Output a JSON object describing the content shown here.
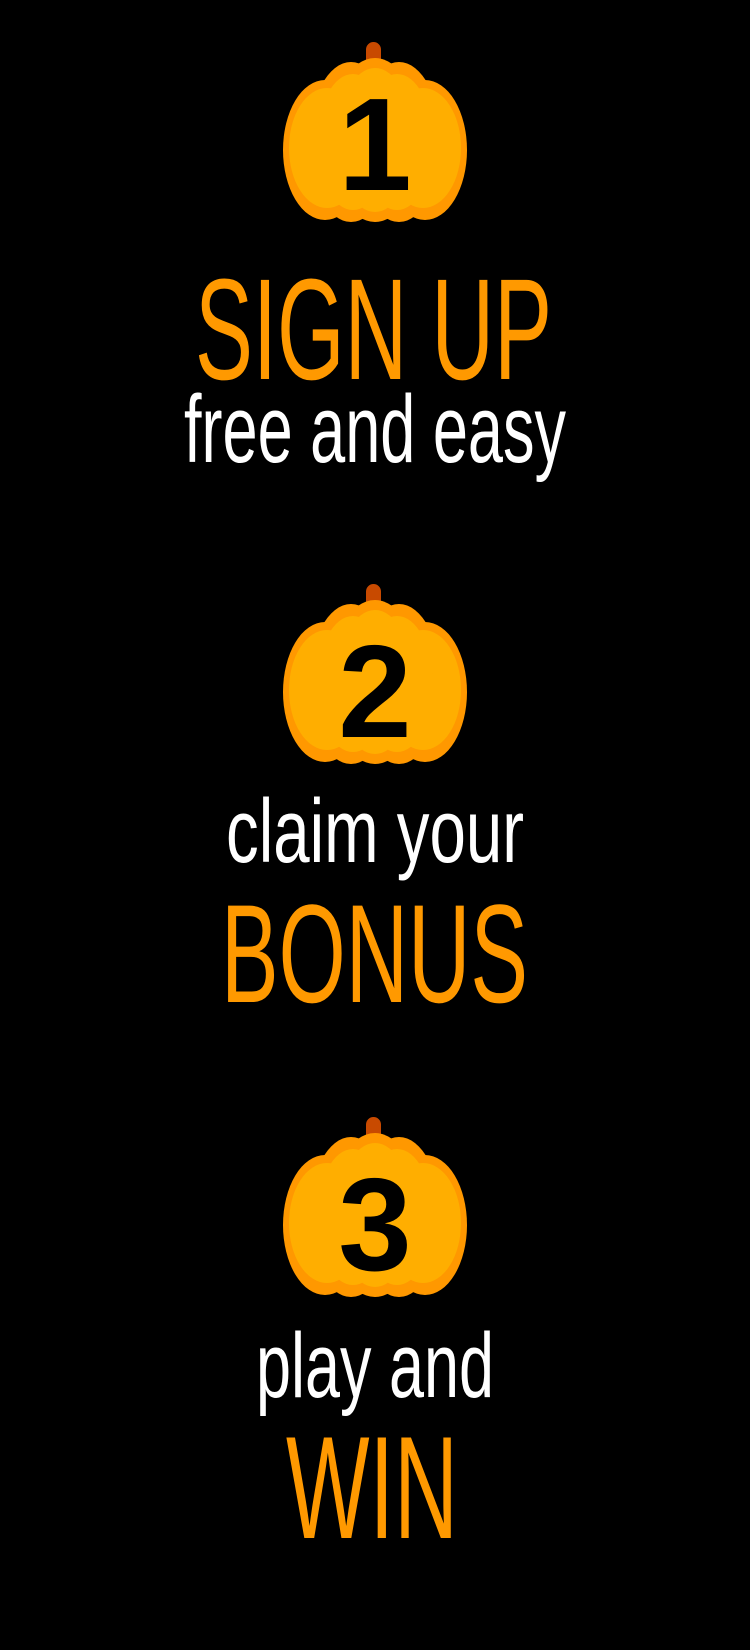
{
  "colors": {
    "background": "#000000",
    "accent": "#FF9900",
    "text": "#FFFFFF",
    "pumpkin_light": "#FFAE00",
    "pumpkin_dark": "#FF9800",
    "stem": "#C84A00"
  },
  "steps": [
    {
      "number": "1",
      "icon": "pumpkin-icon",
      "title": "SIGN UP",
      "subtitle": "free and easy"
    },
    {
      "number": "2",
      "icon": "pumpkin-icon",
      "pre": "claim your",
      "title": "BONUS"
    },
    {
      "number": "3",
      "icon": "pumpkin-icon",
      "pre": "play and",
      "title": "WIN"
    }
  ]
}
